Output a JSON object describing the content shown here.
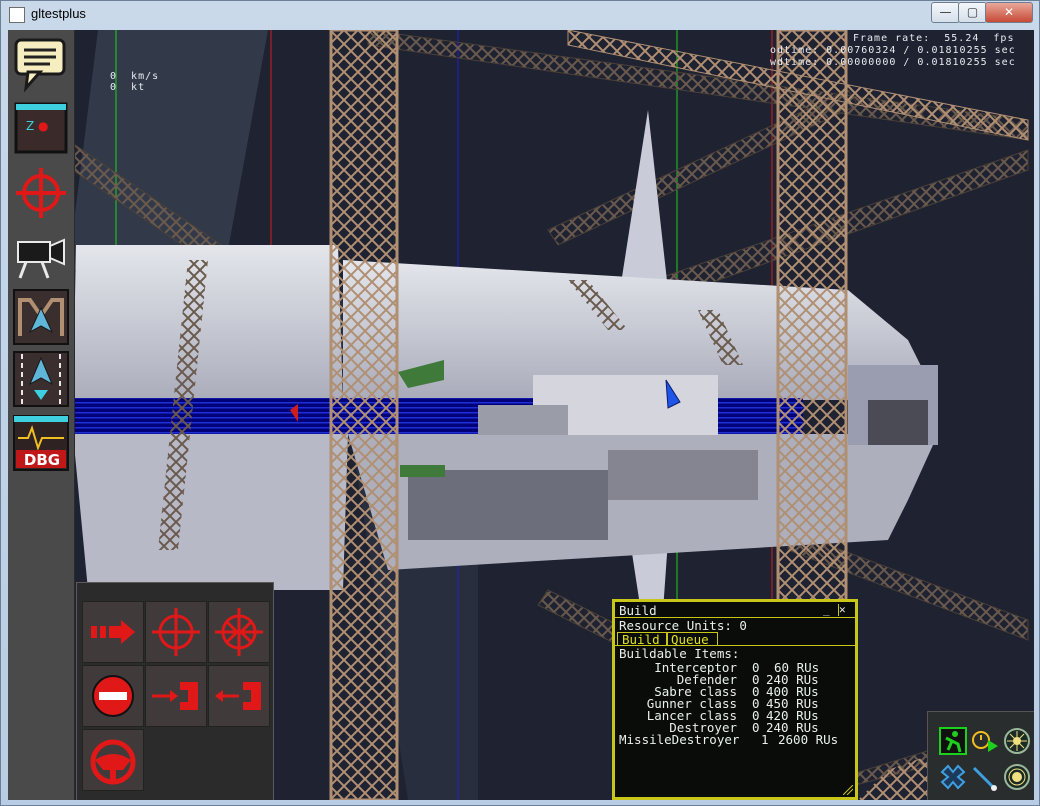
{
  "window": {
    "title": "gltestplus",
    "min_label": "—",
    "max_label": "▢",
    "close_label": "✕"
  },
  "hud": {
    "frame_rate": "Frame rate:  55.24  fps",
    "odtime": "odtime: 0.00760324 / 0.01810255 sec",
    "wdtime": "wdtime: 0.00000000 / 0.01810255 sec",
    "speed_kms": "0  km/s",
    "speed_kt": "0  kt"
  },
  "toolbar": {
    "items": [
      {
        "icon": "chat-icon"
      },
      {
        "icon": "map-icon"
      },
      {
        "icon": "crosshair-icon"
      },
      {
        "icon": "camera-icon"
      },
      {
        "icon": "fleet-icon"
      },
      {
        "icon": "deploy-icon"
      },
      {
        "icon": "debug-icon",
        "label": "DBG"
      }
    ]
  },
  "command_panel": {
    "buttons": [
      {
        "icon": "move-icon"
      },
      {
        "icon": "attack-icon"
      },
      {
        "icon": "force-attack-icon"
      },
      {
        "icon": "halt-icon"
      },
      {
        "icon": "dock-icon"
      },
      {
        "icon": "undock-icon"
      },
      {
        "icon": "steering-icon"
      }
    ]
  },
  "build": {
    "title": "Build",
    "resource_units_label": "Resource Units: 0",
    "tab_build": "Build",
    "tab_queue": "Queue",
    "buildable_label": "Buildable Items:",
    "items": [
      {
        "name": "Interceptor",
        "qty": "0",
        "cost": "60 RUs"
      },
      {
        "name": "Defender",
        "qty": "0",
        "cost": "240 RUs"
      },
      {
        "name": "Sabre class",
        "qty": "0",
        "cost": "400 RUs"
      },
      {
        "name": "Gunner class",
        "qty": "0",
        "cost": "450 RUs"
      },
      {
        "name": "Lancer class",
        "qty": "0",
        "cost": "420 RUs"
      },
      {
        "name": "Destroyer",
        "qty": "0",
        "cost": "240 RUs"
      },
      {
        "name": "MissileDestroyer",
        "qty": "1",
        "cost": "2600 RUs"
      }
    ]
  },
  "tray": {
    "buttons": [
      {
        "icon": "runner-icon"
      },
      {
        "icon": "timer-play-icon"
      },
      {
        "icon": "sun-icon"
      },
      {
        "icon": "formation-icon"
      },
      {
        "icon": "wand-icon"
      },
      {
        "icon": "target-sun-icon"
      }
    ]
  },
  "colors": {
    "build_border": "#c9c61a",
    "toolbar_red": "#e01818",
    "accent_teal": "#3fd0e0"
  }
}
